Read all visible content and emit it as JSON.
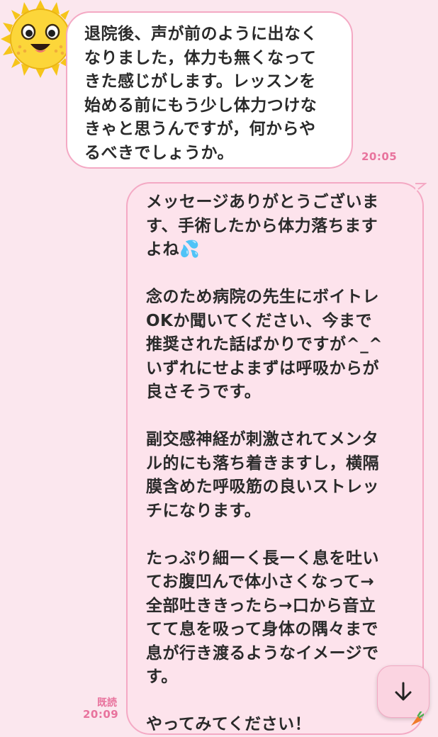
{
  "messages": [
    {
      "direction": "incoming",
      "text": "退院後、声が前のように出なく\nなりました，体力も無くなって\nきた感じがします。レッスンを\n始める前にもう少し体力つけな\nきゃと思うんですが，何からや\nるべきでしょうか。",
      "time": "20:05"
    },
    {
      "direction": "outgoing",
      "text": "メッセージありがとうございま\nす、手術したから体力落ちます\nよね💦\n\n念のため病院の先生にボイトレ\nOKか聞いてください、今まで\n推奨された話ばかりですが^_^\nいずれにせよまずは呼吸からが\n良さそうです。\n\n副交感神経が刺激されてメンタ\nル的にも落ち着きますし，横隔\n膜含めた呼吸筋の良いストレッ\nチになります。\n\nたっぷり細ーく長ーく息を吐い\nてお腹凹んで体小さくなって→\n全部吐ききったら→口から音立\nてて息を吸って身体の隅々まで\n息が行き渡るようなイメージで\nす。\n\nやってみてください！",
      "read_label": "既読",
      "time": "20:09"
    }
  ],
  "avatar_icon": "sun-emoji-avatar-icon",
  "scroll_down_icon": "arrow-down-icon",
  "colors": {
    "background": "#fbe7ee",
    "accent": "#e8739d",
    "bubble_border": "#f4a9c4",
    "outgoing_bubble": "#fde3ec"
  }
}
